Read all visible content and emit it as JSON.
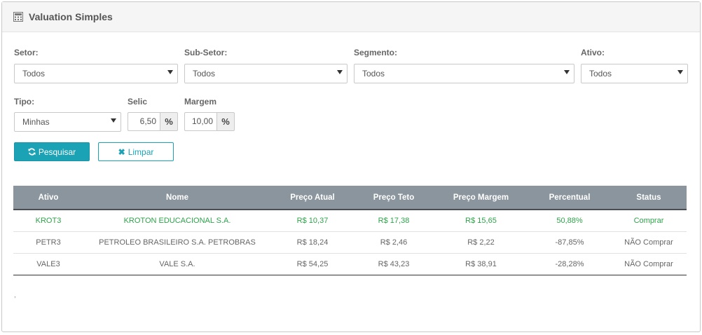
{
  "panel": {
    "title": "Valuation Simples",
    "icon": "calculator-icon"
  },
  "filters": {
    "setor": {
      "label": "Setor:",
      "value": "Todos"
    },
    "subsetor": {
      "label": "Sub-Setor:",
      "value": "Todos"
    },
    "segmento": {
      "label": "Segmento:",
      "value": "Todos"
    },
    "ativo": {
      "label": "Ativo:",
      "value": "Todos"
    },
    "tipo": {
      "label": "Tipo:",
      "value": "Minhas"
    },
    "selic": {
      "label": "Selic",
      "value": "6,50",
      "addon": "%"
    },
    "margem": {
      "label": "Margem",
      "value": "10,00",
      "addon": "%"
    }
  },
  "buttons": {
    "search": {
      "label": "Pesquisar",
      "icon": "refresh-icon"
    },
    "clear": {
      "label": "Limpar",
      "icon": "close-icon"
    }
  },
  "table": {
    "headers": [
      "Ativo",
      "Nome",
      "Preço Atual",
      "Preço Teto",
      "Preço Margem",
      "Percentual",
      "Status"
    ],
    "rows": [
      [
        "KROT3",
        "KROTON EDUCACIONAL S.A.",
        "R$ 10,37",
        "R$ 17,38",
        "R$ 15,65",
        "50,88%",
        "Comprar"
      ],
      [
        "PETR3",
        "PETROLEO BRASILEIRO S.A. PETROBRAS",
        "R$ 18,24",
        "R$ 2,46",
        "R$ 2,22",
        "-87,85%",
        "NÃO Comprar"
      ],
      [
        "VALE3",
        "VALE S.A.",
        "R$ 54,25",
        "R$ 43,23",
        "R$ 38,91",
        "-28,28%",
        "NÃO Comprar"
      ]
    ]
  },
  "footer_mark": ",",
  "colors": {
    "accent": "#1ba2b4",
    "header_bg": "#8b959e",
    "buy": "#2ea34a"
  }
}
